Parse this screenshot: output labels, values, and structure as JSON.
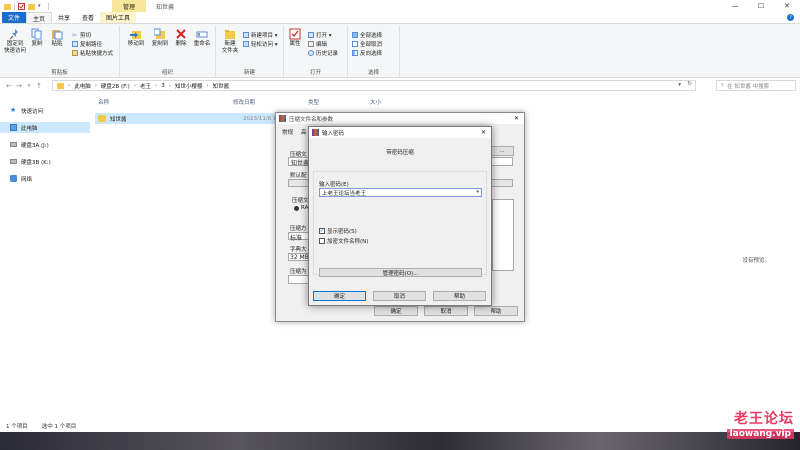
{
  "window": {
    "title": "知世酱",
    "manage_tab": "管理"
  },
  "tabs": [
    "文件",
    "主页",
    "共享",
    "查看",
    "图片工具"
  ],
  "ribbon": {
    "clipboard": {
      "label": "剪贴板",
      "pin": "固定到\n快速访问",
      "copy": "复制",
      "paste": "粘贴",
      "cut": "剪切",
      "copy_path": "复制路径",
      "paste_shortcut": "粘贴快捷方式"
    },
    "organize": {
      "label": "组织",
      "move_to": "移动到",
      "copy_to": "复制到",
      "delete": "删除",
      "rename": "重命名"
    },
    "new": {
      "label": "新建",
      "new_folder": "新建\n文件夹",
      "new_item": "新建项目 ▾",
      "easy_access": "轻松访问 ▾"
    },
    "open": {
      "label": "打开",
      "properties": "属性",
      "open": "打开 ▾",
      "edit": "编辑",
      "history": "历史记录"
    },
    "select": {
      "label": "选择",
      "select_all": "全部选择",
      "select_none": "全部取消",
      "invert": "反向选择"
    }
  },
  "address": {
    "crumbs": [
      "此电脑",
      "硬盘2B (F:)",
      "老王",
      "3",
      "知世小樱樱",
      "知世酱"
    ],
    "search_placeholder": "在 知世酱 中搜索"
  },
  "nav": {
    "items": [
      "快速访问",
      "此电脑",
      "硬盘3A (J:)",
      "硬盘3B (K:)",
      "网络"
    ]
  },
  "columns": {
    "name": "名称",
    "modified": "修改日期",
    "type": "类型",
    "size": "大小"
  },
  "files": [
    {
      "name": "知世酱",
      "modified": "2023/11/6 13"
    }
  ],
  "preview_text": "没有预览。",
  "status": {
    "count": "1 个项目",
    "selected": "选中 1 个项目"
  },
  "watermark": {
    "line1": "老王论坛",
    "line2": "laowang.vip"
  },
  "archive_dialog": {
    "title": "压缩文件名和参数",
    "tabs": [
      "常规",
      "高"
    ],
    "archive_name_label": "压缩文",
    "archive_name_value": "知世酱",
    "browse": "...",
    "profile_label": "默认配",
    "format_label": "压缩文",
    "format_option": "RA",
    "method_label": "压缩方",
    "method_value": "标准",
    "dict_label": "字典大",
    "dict_value": "32 MB",
    "split_label": "压缩为",
    "ok": "确定",
    "cancel": "取消",
    "help": "帮助"
  },
  "password_dialog": {
    "title": "输入密码",
    "subtitle": "带密码压缩",
    "password_label": "输入密码(E)",
    "password_value": "上老王论坛当老王",
    "show_password": "显示密码(S)",
    "show_password_checked": true,
    "encrypt_names": "加密文件名称(N)",
    "encrypt_names_checked": false,
    "manage_passwords": "管理密码(O)...",
    "ok": "确定",
    "cancel": "取消",
    "help": "帮助"
  }
}
